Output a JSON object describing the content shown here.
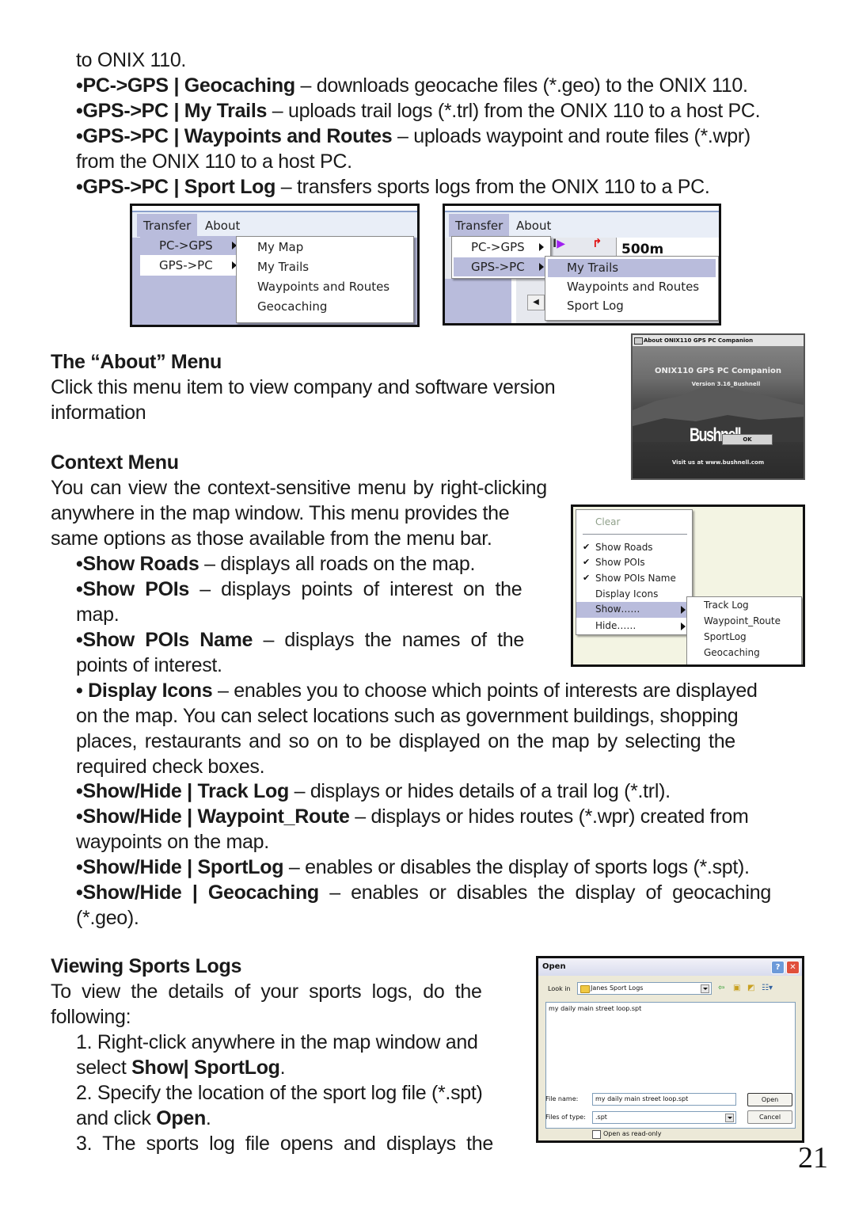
{
  "transfer_list": {
    "intro_tail": "to ONIX 110.",
    "items": [
      {
        "bold": "•PC->GPS | Geocaching",
        "text": " – downloads geocache files (*.geo) to the ONIX 110."
      },
      {
        "bold": "•GPS->PC | My Trails",
        "text": "  – uploads trail logs (*.trl) from the ONIX 110 to a host PC."
      },
      {
        "bold": "•GPS->PC |  Waypoints and  Routes",
        "text": " –  uploads  waypoint  and route files (*.wpr)"
      },
      {
        "bold": "",
        "text": "from the ONIX 110 to a host PC."
      },
      {
        "bold": "•GPS->PC | Sport Log",
        "text": " – transfers sports logs from the ONIX 110 to a PC."
      }
    ]
  },
  "screenshot_pc_gps": {
    "menubar": [
      "Transfer",
      "About"
    ],
    "transfer_menu": [
      "PC->GPS",
      "GPS->PC"
    ],
    "submenu": [
      "My Map",
      "My Trails",
      "Waypoints and Routes",
      "Geocaching"
    ],
    "selected_parent": "PC->GPS"
  },
  "screenshot_gps_pc": {
    "menubar": [
      "Transfer",
      "About"
    ],
    "transfer_menu": [
      "PC->GPS",
      "GPS->PC"
    ],
    "submenu": [
      "My Trails",
      "Waypoints and Routes",
      "Sport Log"
    ],
    "selected_parent": "GPS->PC",
    "selected_item": "My Trails",
    "scale_value": "500m"
  },
  "about_section": {
    "heading": "The “About” Menu",
    "body_line1": "Click this menu item to view company and software version",
    "body_line2": "information"
  },
  "about_dialog": {
    "title": "About ONIX110 GPS PC Companion",
    "product": "ONIX110 GPS PC Companion",
    "version": "Version 3.16_Bushnell",
    "brand": "Bushnell",
    "ok_label": "OK",
    "visit": "Visit us at www.bushnell.com"
  },
  "context_section": {
    "heading": "Context Menu",
    "line1": "You can view the context-sensitive menu by right-clicking",
    "line2": "anywhere in the map window. This menu provides the",
    "line3": "same options as those available from the menu bar.",
    "items": [
      {
        "bold": "•Show Roads",
        "text": " – displays all roads on the map."
      },
      {
        "bold": "•Show  POIs",
        "text": "  –  displays  points  of  interest  on  the"
      },
      {
        "bold": "",
        "text": "map."
      },
      {
        "bold": "•Show  POIs  Name",
        "text": "  –  displays  the  names  of  the"
      },
      {
        "bold": "",
        "text": "points of interest."
      }
    ],
    "display_icons": {
      "bold": "• Display Icons",
      "line1": " – enables you to choose which points of interests are displayed",
      "line2": "on the map. You can select locations such as government buildings, shopping",
      "line3": "places, restaurants and so on to be displayed on the map by selecting the",
      "line4": "required check boxes."
    },
    "show_hide": [
      {
        "bold": "•Show/Hide | Track Log",
        "text": " – displays or hides details of a trail log (*.trl)."
      },
      {
        "bold": "•Show/Hide | Waypoint_Route",
        "text": " – displays or hides routes (*.wpr) created from"
      },
      {
        "bold": "",
        "text": "waypoints on the map."
      },
      {
        "bold": "•Show/Hide | SportLog",
        "text": " – enables or disables the display of sports logs (*.spt)."
      },
      {
        "bold": "•Show/Hide  |  Geocaching",
        "text": "  –  enables  or  disables  the  display  of  geocaching"
      },
      {
        "bold": "",
        "text": "(*.geo)."
      }
    ]
  },
  "context_menu_shot": {
    "clear": "Clear",
    "items": [
      {
        "label": "Show Roads",
        "checked": true
      },
      {
        "label": "Show POIs",
        "checked": true
      },
      {
        "label": "Show POIs Name",
        "checked": true
      },
      {
        "label": "Display Icons",
        "checked": false
      },
      {
        "label": "Show……",
        "submenu": true,
        "selected": true
      },
      {
        "label": "Hide……",
        "submenu": true
      }
    ],
    "submenu": [
      "Track Log",
      "Waypoint_Route",
      "SportLog",
      "Geocaching"
    ]
  },
  "sports_section": {
    "heading": "Viewing Sports Logs",
    "intro1": "To  view  the  details  of  your  sports  logs,  do  the",
    "intro2": "following:",
    "step1a": "1. Right-click anywhere in the map window and",
    "step1b_pre": "select ",
    "step1b_bold": "Show| SportLog",
    "step1b_post": ".",
    "step2a": "2. Specify the location of the sport log file (*.spt)",
    "step2b_pre": "and click ",
    "step2b_bold": "Open",
    "step2b_post": ".",
    "step3": "3.  The  sports  log  file  opens  and  displays  the"
  },
  "open_dialog": {
    "title": "Open",
    "look_in_label": "Look in",
    "look_in_value": "Janes Sport Logs",
    "file_list": [
      "my daily main street loop.spt"
    ],
    "file_name_label": "File name:",
    "file_name_value": "my daily main street loop.spt",
    "file_type_label": "Files of type:",
    "file_type_value": ".spt",
    "open_button": "Open",
    "cancel_button": "Cancel",
    "readonly_label": "Open as read-only",
    "readonly_checked": false
  },
  "page_number": "21"
}
